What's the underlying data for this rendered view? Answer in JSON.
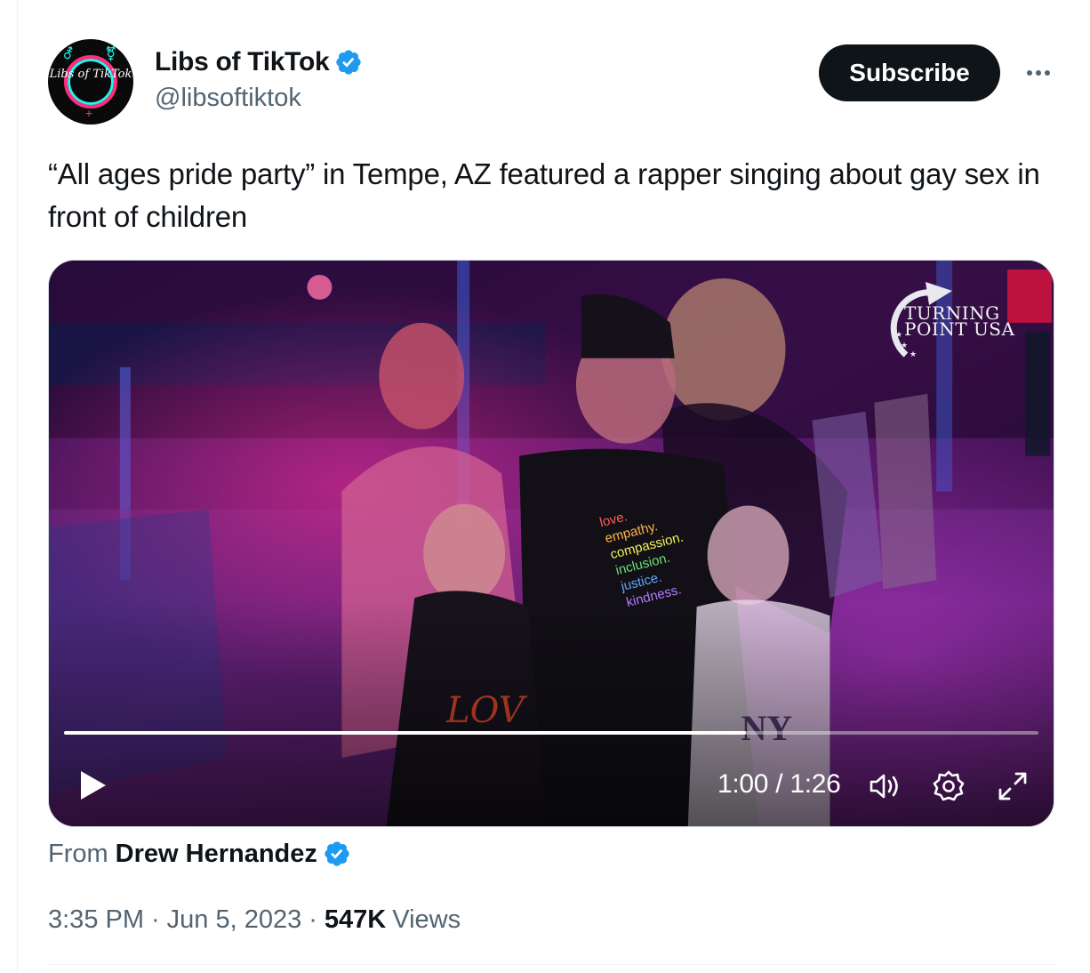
{
  "author": {
    "display_name": "Libs of TikTok",
    "handle": "@libsoftiktok",
    "avatar_text": "Libs of TikTok",
    "verified_icon": "verified-badge-icon"
  },
  "actions": {
    "subscribe_label": "Subscribe",
    "more_icon": "more-dots-icon"
  },
  "tweet": {
    "text": "“All ages pride party” in Tempe, AZ featured a rapper singing about gay sex in front of children"
  },
  "video": {
    "watermark": "TURNING POINT USA",
    "current_time": "1:00",
    "separator": "/",
    "duration": "1:26",
    "progress": 0.7,
    "icons": [
      "play-icon",
      "volume-icon",
      "settings-icon",
      "fullscreen-icon"
    ]
  },
  "attribution": {
    "from_label": "From",
    "source_name": "Drew Hernandez"
  },
  "meta": {
    "time": "3:35 PM",
    "date": "Jun 5, 2023",
    "views_count": "547K",
    "views_label": "Views"
  },
  "colors": {
    "text_primary": "#0f1419",
    "text_secondary": "#536471",
    "verified_blue": "#1d9bf0",
    "button_dark": "#0f1419",
    "border": "#cfd9de"
  }
}
